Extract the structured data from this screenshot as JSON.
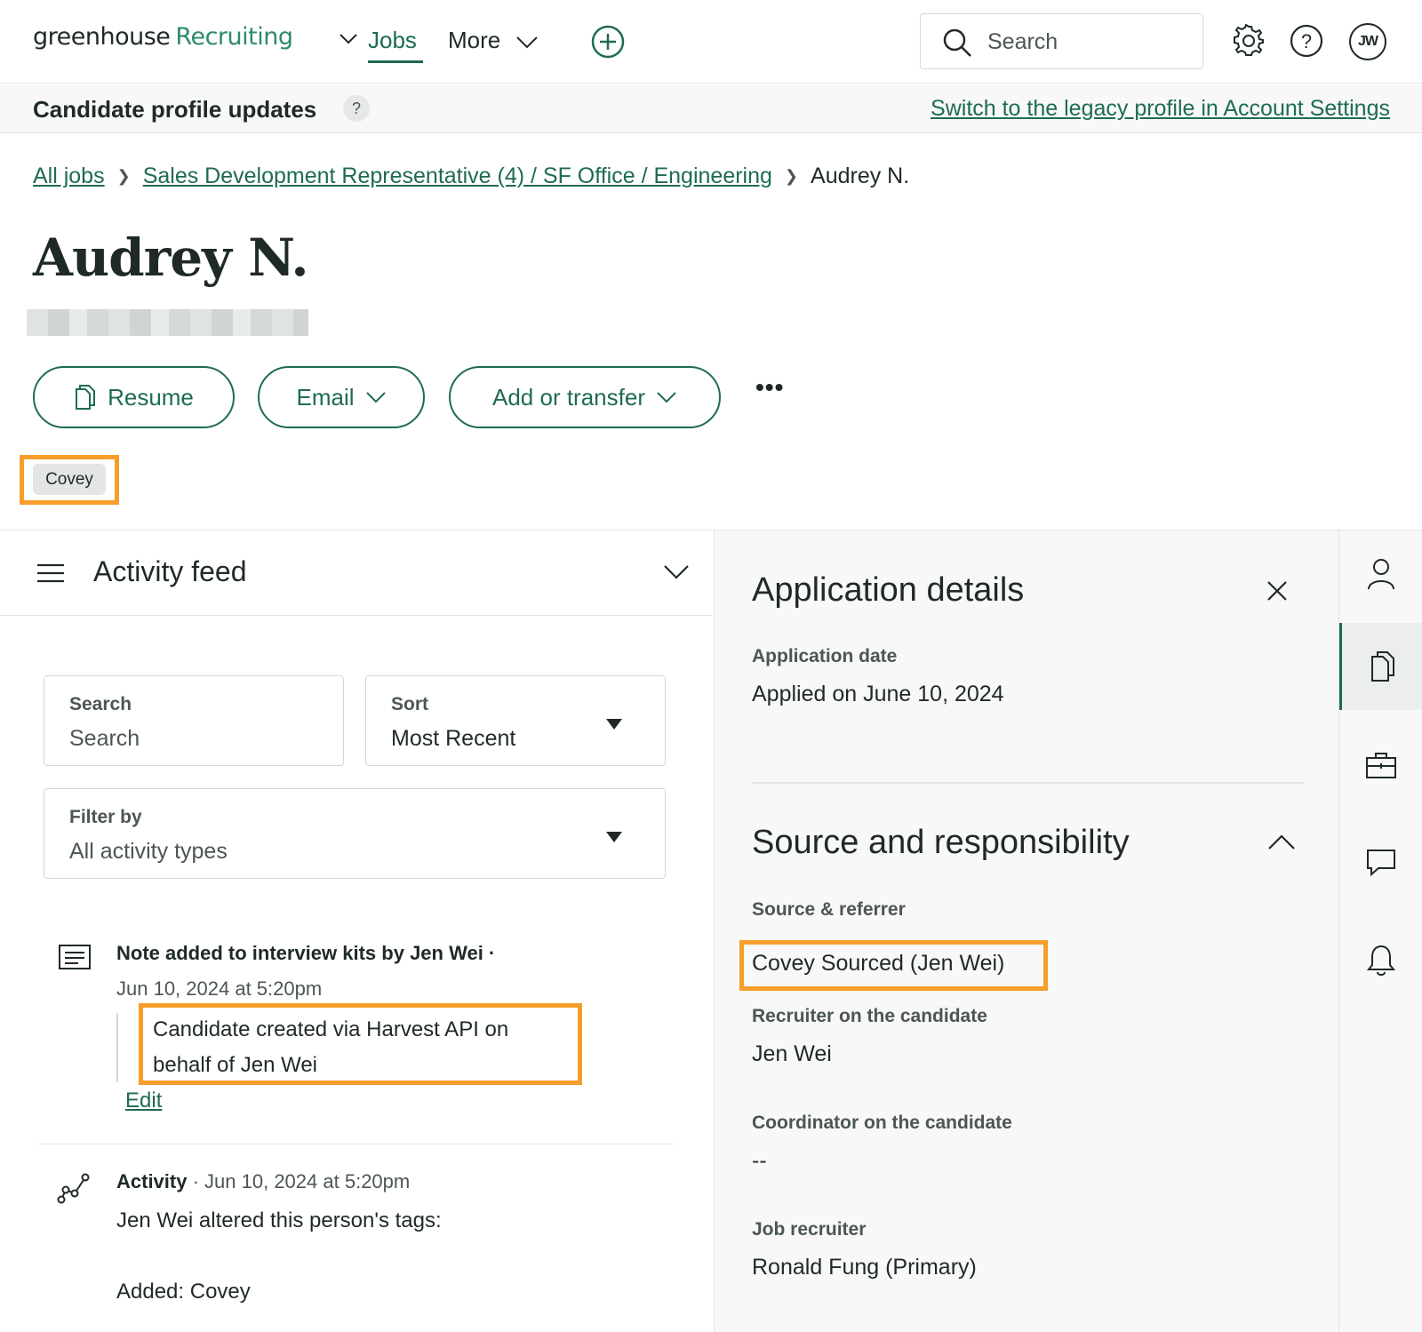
{
  "nav": {
    "brand": "greenhouse",
    "product": "Recruiting",
    "jobs": "Jobs",
    "more": "More",
    "search_placeholder": "Search",
    "avatar_initials": "JW"
  },
  "banner": {
    "title": "Candidate profile updates",
    "help": "?",
    "legacy_link": "Switch to the legacy profile in Account Settings"
  },
  "breadcrumb": {
    "all_jobs": "All jobs",
    "job": "Sales Development Representative (4) / SF Office / Engineering",
    "current": "Audrey N."
  },
  "candidate": {
    "name": "Audrey N.",
    "tag": "Covey"
  },
  "actions": {
    "resume": "Resume",
    "email": "Email",
    "add_transfer": "Add or transfer",
    "more": "•••"
  },
  "activity_feed": {
    "title": "Activity feed",
    "search_label": "Search",
    "search_placeholder": "Search",
    "sort_label": "Sort",
    "sort_value": "Most Recent",
    "filter_label": "Filter by",
    "filter_value": "All activity types",
    "items": [
      {
        "title": "Note added to interview kits by Jen Wei ·",
        "date": "Jun 10, 2024 at 5:20pm",
        "body": "Candidate created via Harvest API on behalf of Jen Wei",
        "edit": "Edit"
      },
      {
        "kind": "Activity",
        "meta": "· Jun 10, 2024 at 5:20pm",
        "line1": "Jen Wei altered this person's tags:",
        "line2": "Added: Covey"
      }
    ]
  },
  "application_details": {
    "title": "Application details",
    "application_date_label": "Application date",
    "application_date_value": "Applied on June 10, 2024",
    "source_section_title": "Source and responsibility",
    "source_label": "Source & referrer",
    "source_value": "Covey Sourced (Jen Wei)",
    "recruiter_label": "Recruiter on the candidate",
    "recruiter_value": "Jen Wei",
    "coordinator_label": "Coordinator on the candidate",
    "coordinator_value": "--",
    "job_recruiter_label": "Job recruiter",
    "job_recruiter_value": "Ronald Fung (Primary)"
  },
  "colors": {
    "brand_green": "#1e6b55",
    "highlight_orange": "#f79e2a"
  }
}
